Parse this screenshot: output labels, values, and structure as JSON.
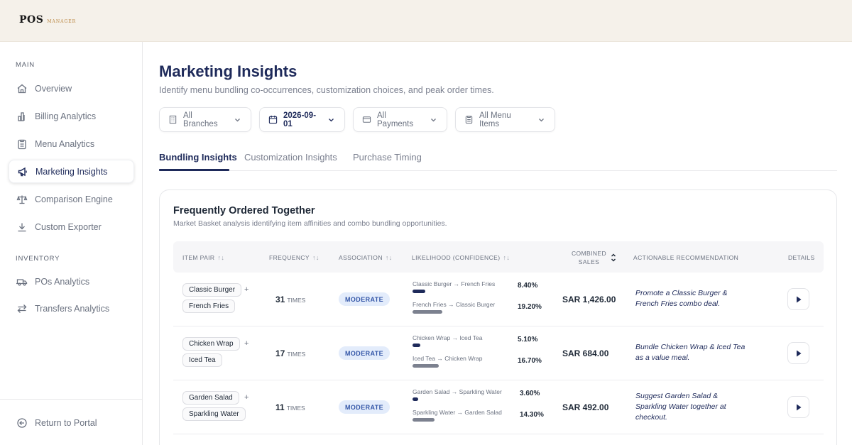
{
  "brand": {
    "name": "POS",
    "sub": "MANAGER"
  },
  "sidebar": {
    "main_section": "MAIN",
    "inventory_section": "INVENTORY",
    "items": [
      {
        "label": "Overview",
        "icon": "home-icon"
      },
      {
        "label": "Billing Analytics",
        "icon": "bar-chart-icon"
      },
      {
        "label": "Menu Analytics",
        "icon": "clipboard-icon"
      },
      {
        "label": "Marketing Insights",
        "icon": "megaphone-icon",
        "active": true
      },
      {
        "label": "Comparison Engine",
        "icon": "scale-icon"
      },
      {
        "label": "Custom Exporter",
        "icon": "download-icon"
      }
    ],
    "inventory_items": [
      {
        "label": "POs Analytics",
        "icon": "truck-icon"
      },
      {
        "label": "Transfers Analytics",
        "icon": "transfer-icon"
      }
    ],
    "footer": {
      "label": "Return to Portal",
      "icon": "arrow-left-circle-icon"
    }
  },
  "page": {
    "title": "Marketing Insights",
    "subtitle": "Identify menu bundling co-occurrences, customization choices, and peak order times."
  },
  "filters": {
    "branches": "All Branches",
    "date": "2026-09-01",
    "payments": "All Payments",
    "menu_items": "All Menu Items"
  },
  "tabs": [
    {
      "label": "Bundling Insights",
      "active": true
    },
    {
      "label": "Customization Insights"
    },
    {
      "label": "Purchase Timing"
    }
  ],
  "card": {
    "title": "Frequently Ordered Together",
    "subtitle": "Market Basket analysis identifying item affinities and combo bundling opportunities."
  },
  "table": {
    "headers": {
      "item_pair": "ITEM PAIR",
      "frequency": "FREQUENCY",
      "association": "ASSOCIATION",
      "likelihood": "LIKELIHOOD (CONFIDENCE)",
      "combined_sales_1": "COMBINED",
      "combined_sales_2": "SALES",
      "recommendation": "ACTIONABLE RECOMMENDATION",
      "details": "DETAILS"
    },
    "sort_glyph": "↑↓",
    "plus": "+",
    "times_unit": "TIMES",
    "rows": [
      {
        "item_a": "Classic Burger",
        "item_b": "French Fries",
        "frequency": "31",
        "association": "MODERATE",
        "ab_label": "Classic Burger → French Fries",
        "ab_value": "8.40%",
        "ab_pct": 8.4,
        "ba_label": "French Fries → Classic Burger",
        "ba_value": "19.20%",
        "ba_pct": 19.2,
        "sales": "SAR 1,426.00",
        "recommendation": "Promote a Classic Burger & French Fries combo deal."
      },
      {
        "item_a": "Chicken Wrap",
        "item_b": "Iced Tea",
        "frequency": "17",
        "association": "MODERATE",
        "ab_label": "Chicken Wrap → Iced Tea",
        "ab_value": "5.10%",
        "ab_pct": 5.1,
        "ba_label": "Iced Tea → Chicken Wrap",
        "ba_value": "16.70%",
        "ba_pct": 16.7,
        "sales": "SAR 684.00",
        "recommendation": "Bundle Chicken Wrap & Iced Tea as a value meal."
      },
      {
        "item_a": "Garden Salad",
        "item_b": "Sparkling Water",
        "frequency": "11",
        "association": "MODERATE",
        "ab_label": "Garden Salad → Sparkling Water",
        "ab_value": "3.60%",
        "ab_pct": 3.6,
        "ba_label": "Sparkling Water → Garden Salad",
        "ba_value": "14.30%",
        "ba_pct": 14.3,
        "sales": "SAR 492.00",
        "recommendation": "Suggest Garden Salad & Sparkling Water together at checkout."
      }
    ]
  }
}
